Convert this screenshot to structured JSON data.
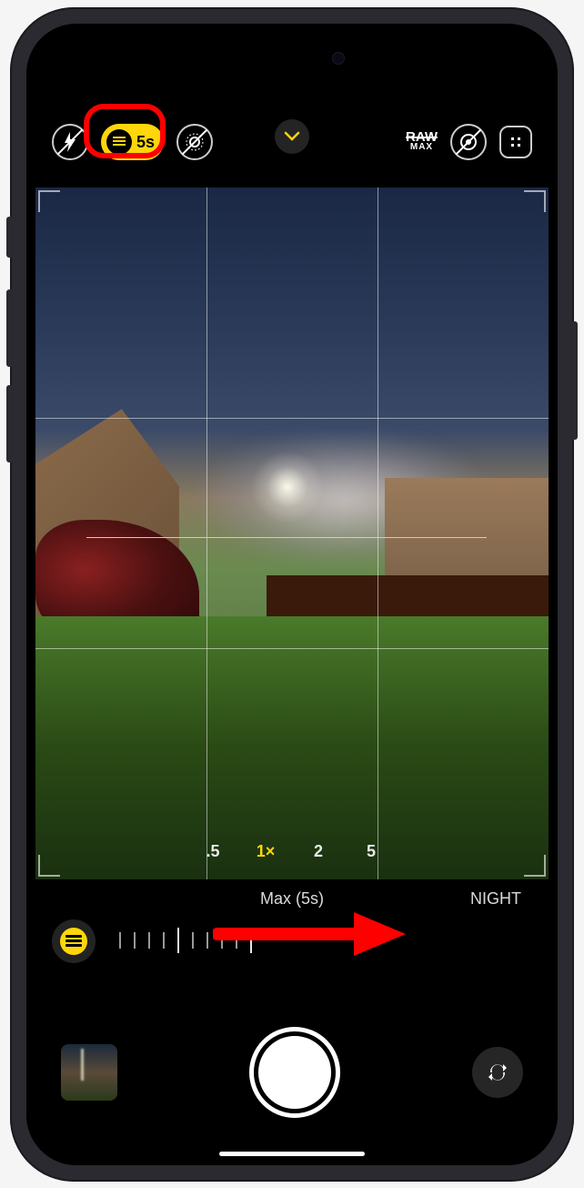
{
  "top_bar": {
    "night_mode_duration": "5s",
    "raw_label": "RAW",
    "raw_sub": "MAX"
  },
  "zoom": {
    "options": [
      ".5",
      "1×",
      "2",
      "5"
    ],
    "active_index": 1
  },
  "night_panel": {
    "duration_label": "Max (5s)",
    "mode_label": "NIGHT"
  },
  "annotations": {
    "highlight": "night-mode-indicator",
    "arrow_direction": "right"
  },
  "colors": {
    "accent_yellow": "#ffd60a",
    "annotation_red": "#ff0000"
  }
}
